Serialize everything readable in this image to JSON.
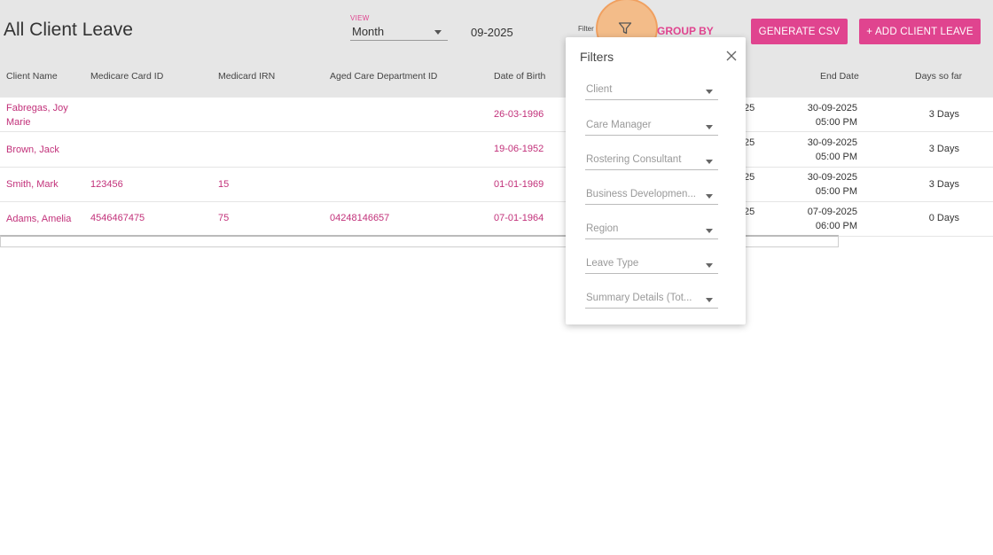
{
  "header": {
    "title": "All Client Leave",
    "view_label": "VIEW",
    "view_value": "Month",
    "date_value": "09-2025",
    "filter_label": "Filter",
    "group_by_label": "GROUP BY",
    "generate_csv_label": "GENERATE CSV",
    "add_leave_label": "+ ADD CLIENT LEAVE",
    "accent_color": "#e0448f"
  },
  "table": {
    "columns": [
      "Client Name",
      "Medicare Card ID",
      "Medicard IRN",
      "Aged Care Department ID",
      "Date of Birth",
      "End Date",
      "Days so far"
    ],
    "rows": [
      {
        "client_line1": "Fabregas, Joy",
        "client_line2": "Marie",
        "medicare_id": "",
        "irn": "",
        "aged_care_id": "",
        "dob": "26-03-1996",
        "partial": "25",
        "end_date": "30-09-2025",
        "end_time": "05:00 PM",
        "days": "3 Days"
      },
      {
        "client_line1": "Brown, Jack",
        "client_line2": "",
        "medicare_id": "",
        "irn": "",
        "aged_care_id": "",
        "dob": "19-06-1952",
        "partial": "25",
        "end_date": "30-09-2025",
        "end_time": "05:00 PM",
        "days": "3 Days"
      },
      {
        "client_line1": "Smith, Mark",
        "client_line2": "",
        "medicare_id": "123456",
        "irn": "15",
        "aged_care_id": "",
        "dob": "01-01-1969",
        "partial": "25",
        "end_date": "30-09-2025",
        "end_time": "05:00 PM",
        "days": "3 Days"
      },
      {
        "client_line1": "Adams, Amelia",
        "client_line2": "",
        "medicare_id": "4546467475",
        "irn": "75",
        "aged_care_id": "04248146657",
        "dob": "07-01-1964",
        "partial": "25",
        "end_date": "07-09-2025",
        "end_time": "06:00 PM",
        "days": "0 Days"
      }
    ]
  },
  "filters": {
    "title": "Filters",
    "fields": [
      "Client",
      "Care Manager",
      "Rostering Consultant",
      "Business Developmen...",
      "Region",
      "Leave Type",
      "Summary Details (Tot..."
    ]
  },
  "icons": {
    "filter": "filter-funnel-icon",
    "close": "close-icon",
    "caret": "caret-down-icon"
  }
}
